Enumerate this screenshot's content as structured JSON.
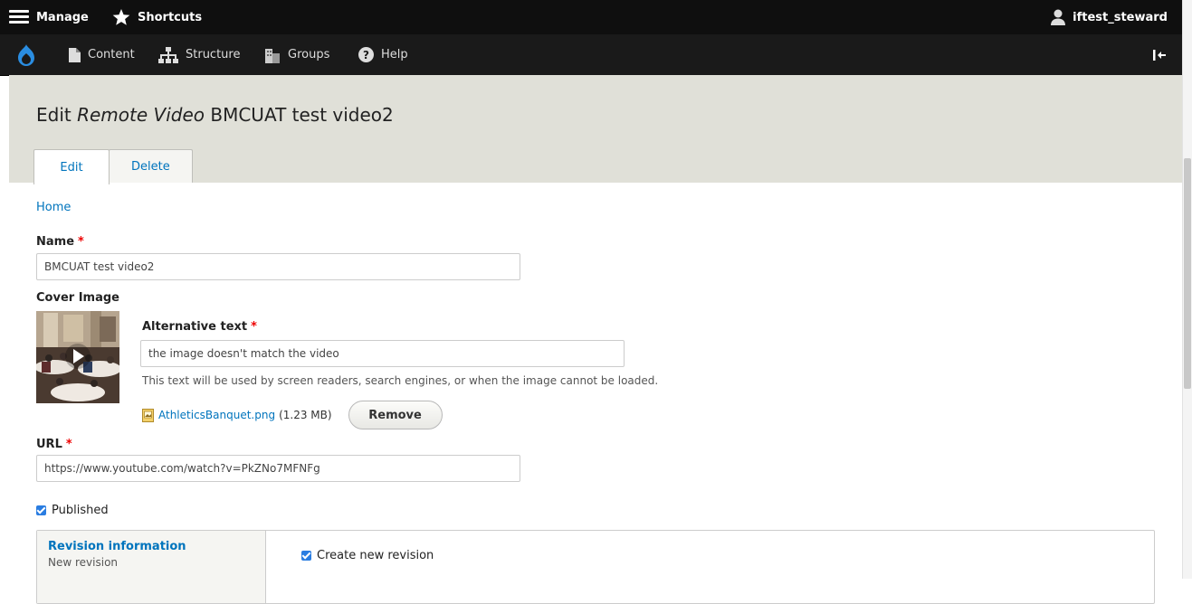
{
  "toolbar": {
    "manage_label": "Manage",
    "shortcuts_label": "Shortcuts",
    "user_label": "iftest_steward"
  },
  "tray": {
    "content_label": "Content",
    "structure_label": "Structure",
    "groups_label": "Groups",
    "help_label": "Help"
  },
  "header": {
    "title_prefix": "Edit ",
    "title_type": "Remote Video",
    "title_name": " BMCUAT test video2",
    "tabs": [
      {
        "label": "Edit",
        "active": true
      },
      {
        "label": "Delete",
        "active": false
      }
    ]
  },
  "breadcrumb": {
    "home": "Home"
  },
  "form": {
    "name_label": "Name",
    "name_value": "BMCUAT test video2",
    "required_marker": "*",
    "cover_image_label": "Cover Image",
    "alt_text_label": "Alternative text",
    "alt_text_value": "the image doesn't match the video",
    "alt_text_description": "This text will be used by screen readers, search engines, or when the image cannot be loaded.",
    "file_name": "AthleticsBanquet.png",
    "file_size": "(1.23 MB)",
    "remove_button": "Remove",
    "url_label": "URL",
    "url_value": "https://www.youtube.com/watch?v=PkZNo7MFNFg",
    "published_label": "Published",
    "revision": {
      "title": "Revision information",
      "summary": "New revision",
      "create_new_label": "Create new revision"
    }
  },
  "colors": {
    "link": "#0074bd",
    "toolbar_bg": "#0f0f0f",
    "header_bg": "#e0e0d8",
    "required": "#e00000",
    "checkbox": "#2a7de1"
  }
}
